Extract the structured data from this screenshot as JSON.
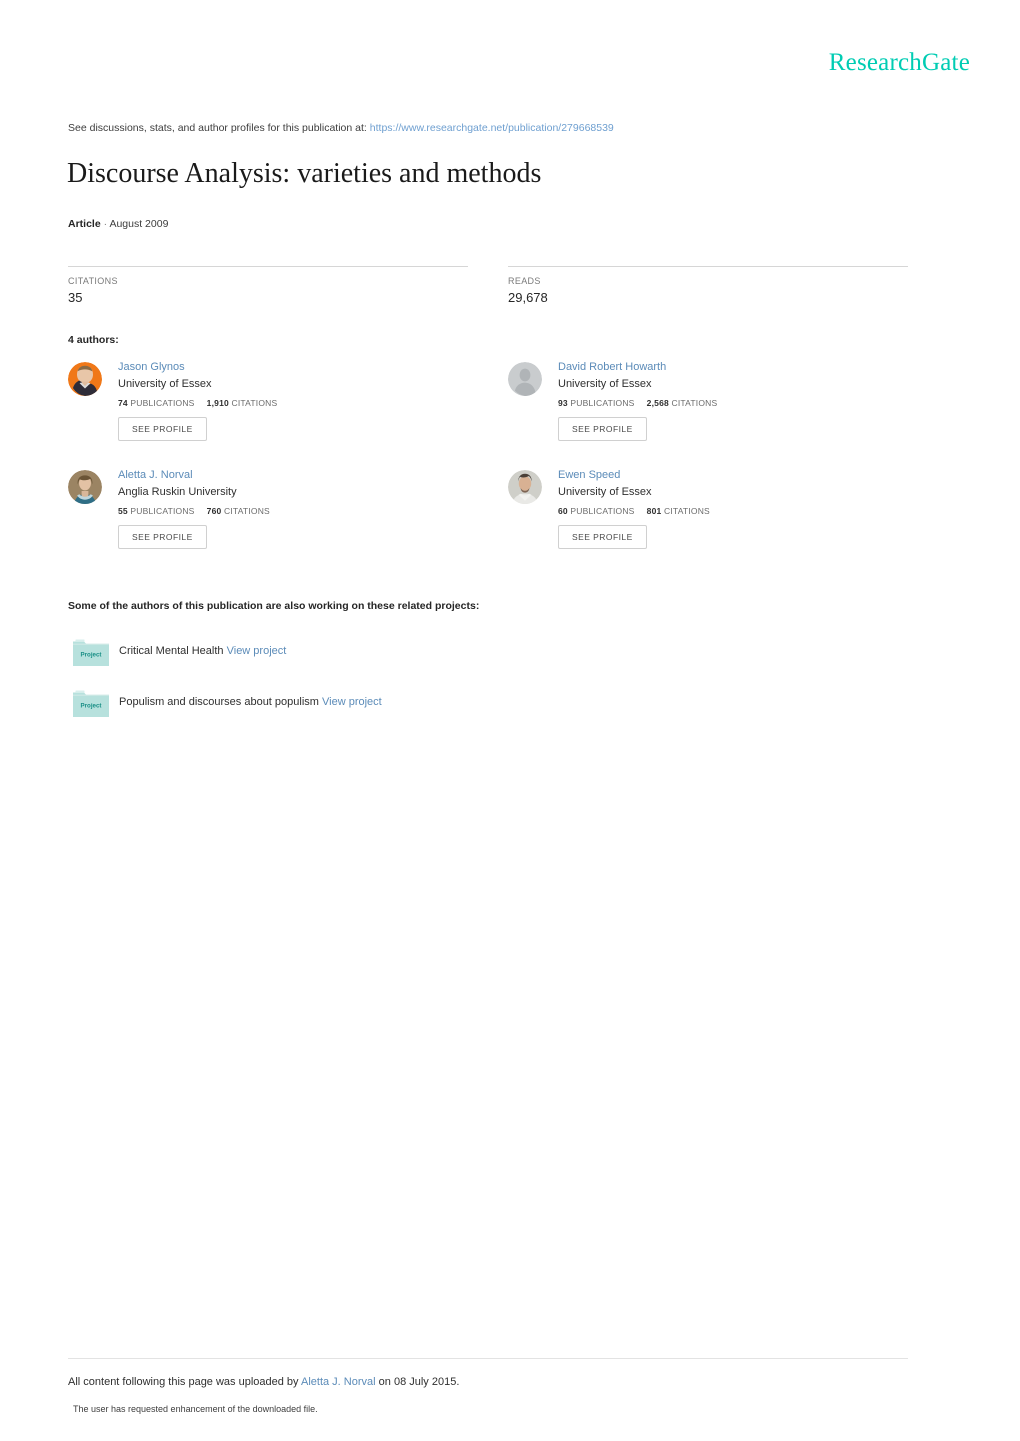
{
  "brand": {
    "name": "ResearchGate",
    "color": "#00ccb3"
  },
  "discussion": {
    "prefix": "See discussions, stats, and author profiles for this publication at:",
    "url": "https://www.researchgate.net/publication/279668539"
  },
  "publication": {
    "title": "Discourse Analysis: varieties and methods",
    "type": "Article",
    "separator": "·",
    "date": "August 2009"
  },
  "stats": {
    "citations": {
      "label": "CITATIONS",
      "value": "35"
    },
    "reads": {
      "label": "READS",
      "value": "29,678"
    }
  },
  "authors_section": {
    "heading": "4 authors:",
    "publications_label": "PUBLICATIONS",
    "citations_label": "CITATIONS",
    "see_profile_label": "SEE PROFILE",
    "authors": [
      {
        "name": "Jason Glynos",
        "affiliation": "University of Essex",
        "publications": "74",
        "citations": "1,910",
        "avatar": "photo-orange"
      },
      {
        "name": "David Robert Howarth",
        "affiliation": "University of Essex",
        "publications": "93",
        "citations": "2,568",
        "avatar": "placeholder-gray"
      },
      {
        "name": "Aletta J. Norval",
        "affiliation": "Anglia Ruskin University",
        "publications": "55",
        "citations": "760",
        "avatar": "photo-tan"
      },
      {
        "name": "Ewen Speed",
        "affiliation": "University of Essex",
        "publications": "60",
        "citations": "801",
        "avatar": "photo-gray"
      }
    ]
  },
  "projects_section": {
    "heading": "Some of the authors of this publication are also working on these related projects:",
    "icon_label": "Project",
    "view_label": "View project",
    "projects": [
      {
        "title": "Critical Mental Health"
      },
      {
        "title": "Populism and discourses about populism"
      }
    ]
  },
  "footer": {
    "prefix": "All content following this page was uploaded by",
    "uploader": "Aletta J. Norval",
    "suffix": "on 08 July 2015.",
    "note": "The user has requested enhancement of the downloaded file."
  }
}
